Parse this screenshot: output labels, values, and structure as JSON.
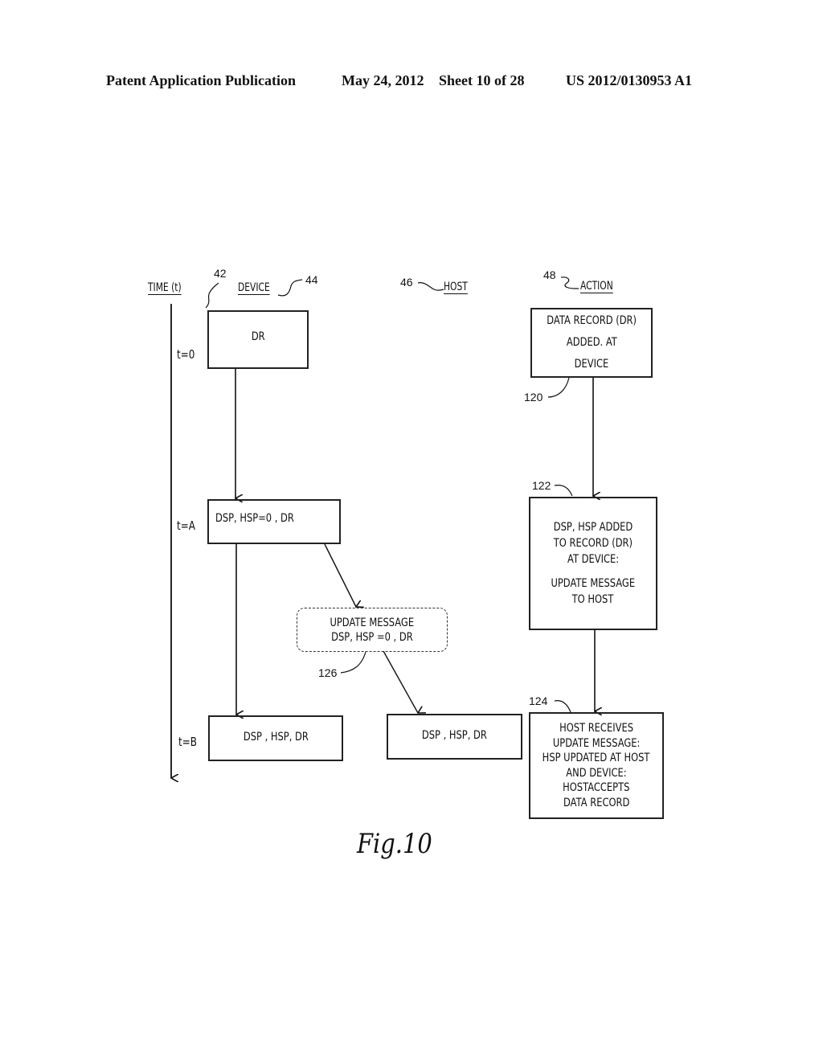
{
  "header": {
    "publication": "Patent Application Publication",
    "date": "May 24, 2012",
    "sheet": "Sheet 10 of 28",
    "number": "US 2012/0130953 A1"
  },
  "columns": {
    "time": {
      "label": "TIME (t)",
      "ref": "42"
    },
    "device": {
      "label": "DEVICE",
      "ref": "44"
    },
    "host": {
      "label": "HOST",
      "ref": "46"
    },
    "action": {
      "label": "ACTION",
      "ref": "48"
    }
  },
  "time_labels": [
    "t=0",
    "t=A",
    "t=B"
  ],
  "device_states": {
    "t0": "DR",
    "tA": "DSP, HSP=0 , DR",
    "tB": "DSP , HSP, DR"
  },
  "host_states": {
    "tB": "DSP , HSP, DR"
  },
  "message": {
    "lines": [
      "UPDATE MESSAGE",
      "DSP, HSP =0 , DR"
    ],
    "ref": "126"
  },
  "actions": [
    {
      "ref": "120",
      "lines": [
        "DATA RECORD (DR)",
        "ADDED. AT",
        "DEVICE"
      ]
    },
    {
      "ref": "122",
      "lines": [
        "DSP, HSP ADDED",
        "TO RECORD (DR)",
        "AT DEVICE:",
        "",
        "UPDATE MESSAGE",
        "TO HOST"
      ]
    },
    {
      "ref": "124",
      "lines": [
        "HOST RECEIVES",
        "UPDATE MESSAGE:",
        "HSP UPDATED AT HOST",
        "AND DEVICE:",
        "HOSTACCEPTS",
        "DATA RECORD"
      ]
    }
  ],
  "figure_caption": "Fig.10"
}
